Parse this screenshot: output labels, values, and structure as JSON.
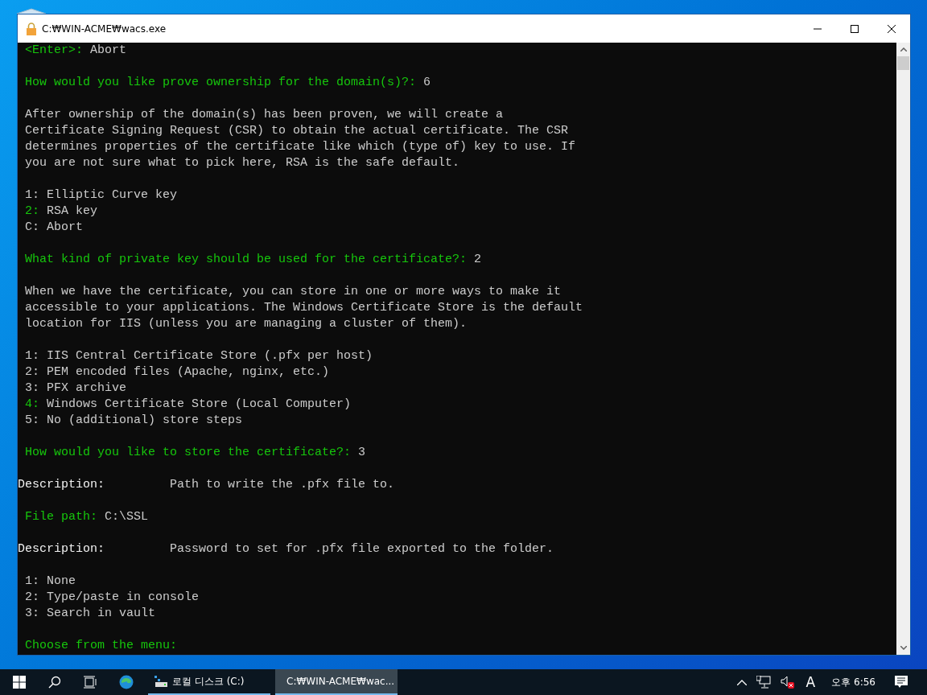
{
  "window": {
    "title": "C:₩WIN-ACME₩wacs.exe"
  },
  "console": {
    "lines": [
      {
        "kind": "text",
        "segments": [
          {
            "kind": "prompt",
            "text": " <Enter>: "
          },
          {
            "kind": "text",
            "text": "Abort"
          }
        ]
      },
      {
        "kind": "blank"
      },
      {
        "kind": "text",
        "segments": [
          {
            "kind": "prompt",
            "text": " How would you like prove ownership for the domain(s)?: "
          },
          {
            "kind": "text",
            "text": "6"
          }
        ]
      },
      {
        "kind": "blank"
      },
      {
        "kind": "text",
        "segments": [
          {
            "kind": "text",
            "text": " After ownership of the domain(s) has been proven, we will create a"
          }
        ]
      },
      {
        "kind": "text",
        "segments": [
          {
            "kind": "text",
            "text": " Certificate Signing Request (CSR) to obtain the actual certificate. The CSR"
          }
        ]
      },
      {
        "kind": "text",
        "segments": [
          {
            "kind": "text",
            "text": " determines properties of the certificate like which (type of) key to use. If"
          }
        ]
      },
      {
        "kind": "text",
        "segments": [
          {
            "kind": "text",
            "text": " you are not sure what to pick here, RSA is the safe default."
          }
        ]
      },
      {
        "kind": "blank"
      },
      {
        "kind": "text",
        "segments": [
          {
            "kind": "text",
            "text": " 1: Elliptic Curve key"
          }
        ]
      },
      {
        "kind": "text",
        "segments": [
          {
            "kind": "prompt",
            "text": " 2: "
          },
          {
            "kind": "text",
            "text": "RSA key"
          }
        ]
      },
      {
        "kind": "text",
        "segments": [
          {
            "kind": "text",
            "text": " C: Abort"
          }
        ]
      },
      {
        "kind": "blank"
      },
      {
        "kind": "text",
        "segments": [
          {
            "kind": "prompt",
            "text": " What kind of private key should be used for the certificate?: "
          },
          {
            "kind": "text",
            "text": "2"
          }
        ]
      },
      {
        "kind": "blank"
      },
      {
        "kind": "text",
        "segments": [
          {
            "kind": "text",
            "text": " When we have the certificate, you can store in one or more ways to make it"
          }
        ]
      },
      {
        "kind": "text",
        "segments": [
          {
            "kind": "text",
            "text": " accessible to your applications. The Windows Certificate Store is the default"
          }
        ]
      },
      {
        "kind": "text",
        "segments": [
          {
            "kind": "text",
            "text": " location for IIS (unless you are managing a cluster of them)."
          }
        ]
      },
      {
        "kind": "blank"
      },
      {
        "kind": "text",
        "segments": [
          {
            "kind": "text",
            "text": " 1: IIS Central Certificate Store (.pfx per host)"
          }
        ]
      },
      {
        "kind": "text",
        "segments": [
          {
            "kind": "text",
            "text": " 2: PEM encoded files (Apache, nginx, etc.)"
          }
        ]
      },
      {
        "kind": "text",
        "segments": [
          {
            "kind": "text",
            "text": " 3: PFX archive"
          }
        ]
      },
      {
        "kind": "text",
        "segments": [
          {
            "kind": "prompt",
            "text": " 4: "
          },
          {
            "kind": "text",
            "text": "Windows Certificate Store (Local Computer)"
          }
        ]
      },
      {
        "kind": "text",
        "segments": [
          {
            "kind": "text",
            "text": " 5: No (additional) store steps"
          }
        ]
      },
      {
        "kind": "blank"
      },
      {
        "kind": "text",
        "segments": [
          {
            "kind": "prompt",
            "text": " How would you like to store the certificate?: "
          },
          {
            "kind": "text",
            "text": "3"
          }
        ]
      },
      {
        "kind": "blank"
      },
      {
        "kind": "text",
        "segments": [
          {
            "kind": "bright",
            "text": "Description:         "
          },
          {
            "kind": "text",
            "text": "Path to write the .pfx file to."
          }
        ]
      },
      {
        "kind": "blank"
      },
      {
        "kind": "text",
        "segments": [
          {
            "kind": "prompt",
            "text": " File path: "
          },
          {
            "kind": "text",
            "text": "C:\\SSL"
          }
        ]
      },
      {
        "kind": "blank"
      },
      {
        "kind": "text",
        "segments": [
          {
            "kind": "bright",
            "text": "Description:         "
          },
          {
            "kind": "text",
            "text": "Password to set for .pfx file exported to the folder."
          }
        ]
      },
      {
        "kind": "blank"
      },
      {
        "kind": "text",
        "segments": [
          {
            "kind": "text",
            "text": " 1: None"
          }
        ]
      },
      {
        "kind": "text",
        "segments": [
          {
            "kind": "text",
            "text": " 2: Type/paste in console"
          }
        ]
      },
      {
        "kind": "text",
        "segments": [
          {
            "kind": "text",
            "text": " 3: Search in vault"
          }
        ]
      },
      {
        "kind": "blank"
      },
      {
        "kind": "text",
        "segments": [
          {
            "kind": "prompt",
            "text": " Choose from the menu:"
          }
        ]
      }
    ]
  },
  "taskbar": {
    "items": [
      {
        "kind": "explorer",
        "label": "로컬 디스크 (C:)",
        "selected": false
      },
      {
        "kind": "console",
        "label": "C:₩WIN-ACME₩wac...",
        "selected": true
      }
    ],
    "ime": "A",
    "clock": "오후 6:56"
  }
}
